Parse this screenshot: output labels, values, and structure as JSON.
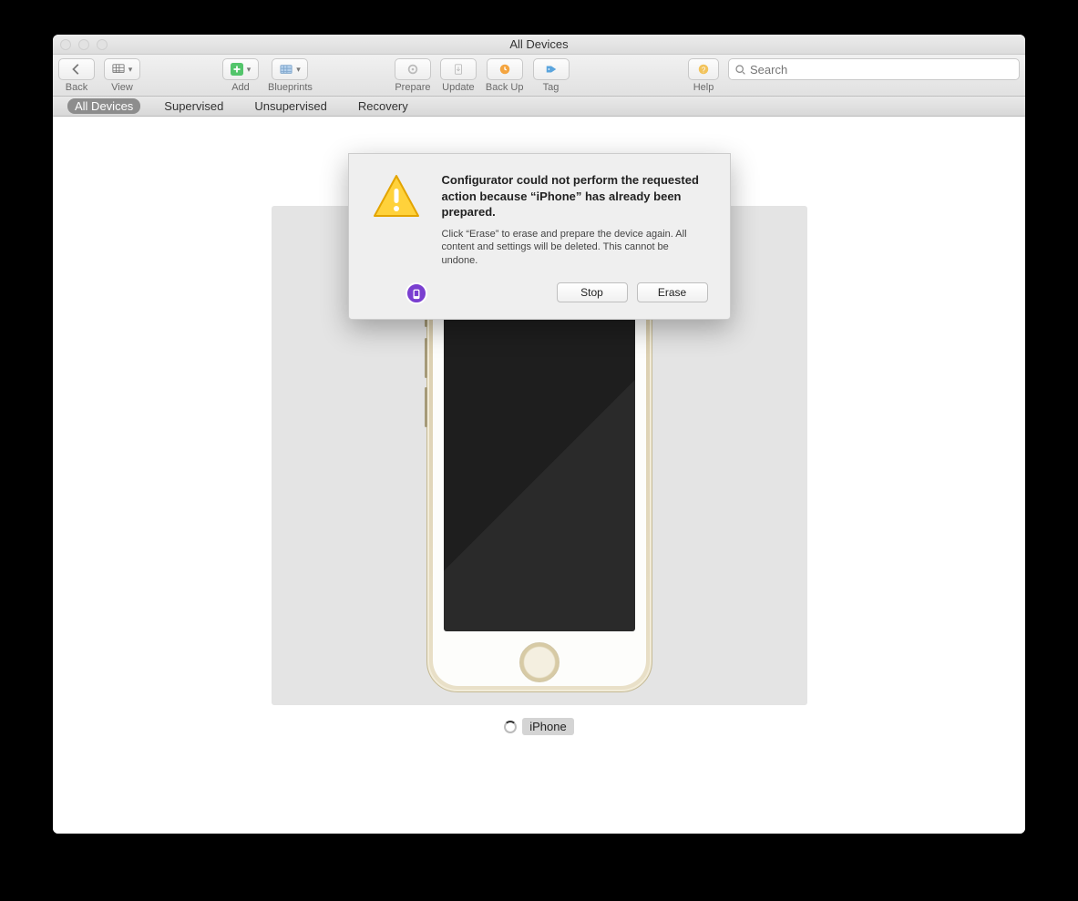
{
  "window": {
    "title": "All Devices"
  },
  "toolbar": {
    "back_label": "Back",
    "view_label": "View",
    "add_label": "Add",
    "blueprints_label": "Blueprints",
    "prepare_label": "Prepare",
    "update_label": "Update",
    "backup_label": "Back Up",
    "tag_label": "Tag",
    "help_label": "Help",
    "search_placeholder": "Search"
  },
  "filters": {
    "all": "All Devices",
    "supervised": "Supervised",
    "unsupervised": "Unsupervised",
    "recovery": "Recovery"
  },
  "device": {
    "label": "iPhone"
  },
  "dialog": {
    "title": "Configurator could not perform the requested action because “iPhone” has already been prepared.",
    "body": "Click “Erase” to erase and prepare the device again. All content and settings will be deleted. This cannot be undone.",
    "stop": "Stop",
    "erase": "Erase"
  }
}
